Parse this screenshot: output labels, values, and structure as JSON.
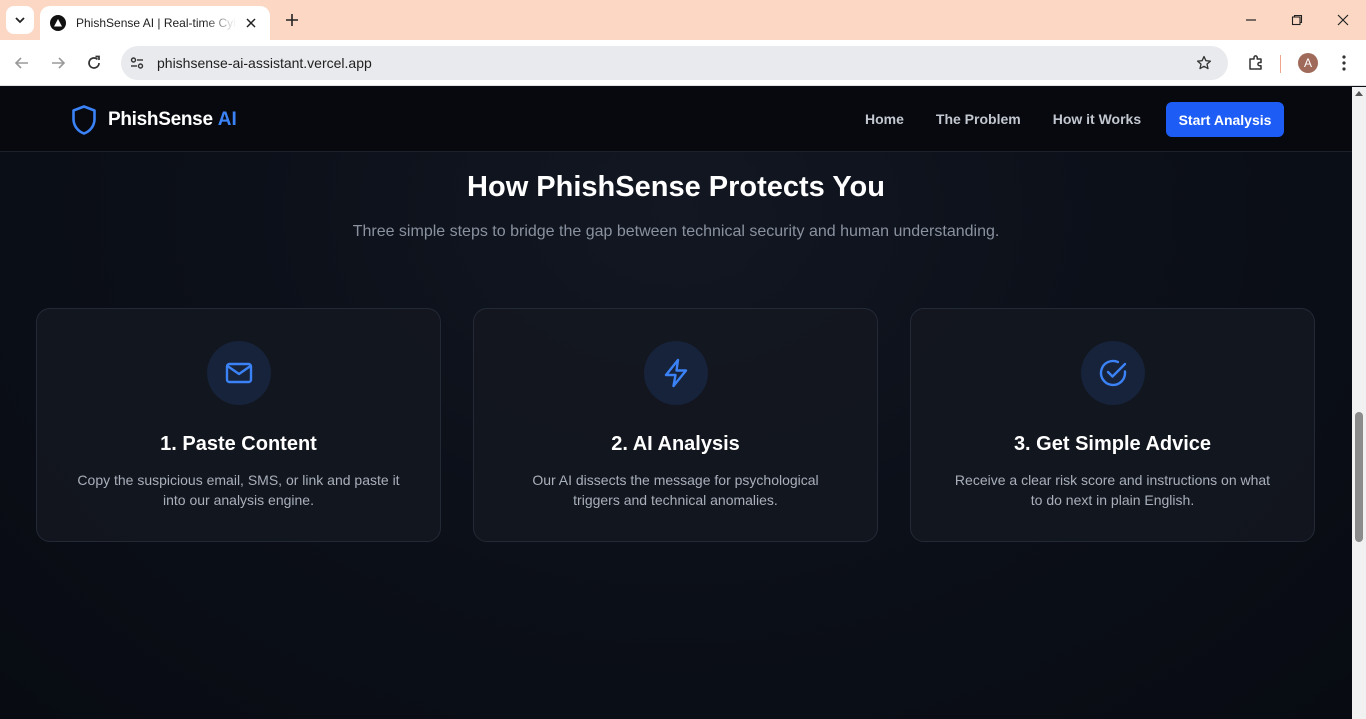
{
  "browser": {
    "tab_title": "PhishSense AI | Real-time Cyber",
    "url": "phishsense-ai-assistant.vercel.app",
    "profile_initial": "A"
  },
  "nav": {
    "brand_name": "PhishSense",
    "brand_suffix": "AI",
    "links": [
      "Home",
      "The Problem",
      "How it Works"
    ],
    "cta": "Start Analysis"
  },
  "section": {
    "title": "How PhishSense Protects You",
    "subtitle": "Three simple steps to bridge the gap between technical security and human understanding."
  },
  "steps": [
    {
      "icon": "mail-icon",
      "title": "1. Paste Content",
      "description": "Copy the suspicious email, SMS, or link and paste it into our analysis engine."
    },
    {
      "icon": "lightning-icon",
      "title": "2. AI Analysis",
      "description": "Our AI dissects the message for psychological triggers and technical anomalies."
    },
    {
      "icon": "check-circle-icon",
      "title": "3. Get Simple Advice",
      "description": "Receive a clear risk score and instructions on what to do next in plain English."
    }
  ],
  "colors": {
    "accent": "#3b82f6",
    "cta": "#1d5cf5",
    "background": "#0b0e14",
    "tab_strip": "#fcd8c4"
  }
}
